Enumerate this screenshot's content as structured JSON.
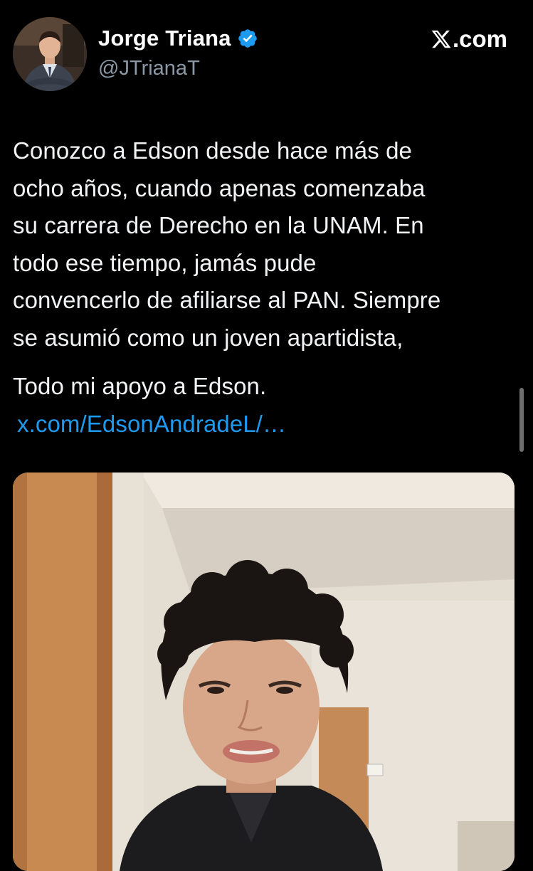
{
  "author": {
    "name": "Jorge Triana",
    "handle": "@JTrianaT",
    "verified_icon": "verified-badge-icon",
    "badge_color": "#1d9bf0"
  },
  "source": {
    "label": ".com",
    "icon": "x-logo-icon"
  },
  "tweet": {
    "paragraph1": "Conozco a Edson desde hace más de\nocho años, cuando apenas comenzaba\nsu carrera de Derecho en la UNAM. En\ntodo ese tiempo, jamás pude\nconvencerlo de afiliarse al PAN. Siempre\nse asumió como un joven apartidista,",
    "paragraph2": "Todo mi apoyo a Edson.",
    "link_text": "x.com/EdsonAndradeL/…",
    "link_color": "#1d9bf0"
  },
  "media": {
    "type": "video-thumbnail"
  },
  "theme": {
    "background": "#000000",
    "text": "#e7e9ea",
    "secondary_text": "#8b98a5"
  }
}
